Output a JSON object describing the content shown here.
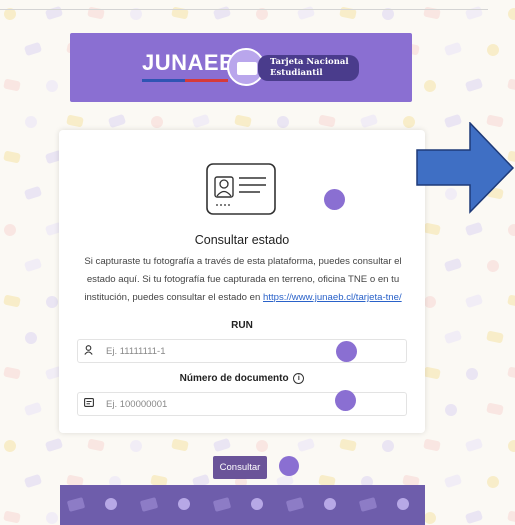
{
  "header": {
    "brand": "JUNAEB",
    "tne_label_line1": "Tarjeta Nacional",
    "tne_label_line2": "Estudiantil",
    "colors": {
      "header_bg": "#8a6fd2",
      "stripe": [
        "#2f54b3",
        "#d63a3a"
      ]
    }
  },
  "card": {
    "title": "Consultar estado",
    "description_part1": "Si capturaste tu fotografía a través de esta plataforma, puedes consultar el estado aquí. Si tu fotografía fue capturada en terreno, oficina TNE o en tu institución, puedes consultar el estado en ",
    "description_link": "https://www.junaeb.cl/tarjeta-tne/",
    "run_label": "RUN",
    "run_placeholder": "Ej. 11111111-1",
    "run_icon": "user-icon",
    "doc_label": "Número de documento",
    "doc_placeholder": "Ej. 100000001",
    "doc_icon": "document-icon",
    "info_icon": "info-icon"
  },
  "submit_label": "Consultar",
  "annotation": {
    "marker": "purple-dot",
    "arrow": "arrow-right"
  },
  "colors": {
    "accent": "#8a6fd2",
    "button": "#6a5499",
    "arrow": "#3f6fc4",
    "link": "#2a62c9"
  }
}
